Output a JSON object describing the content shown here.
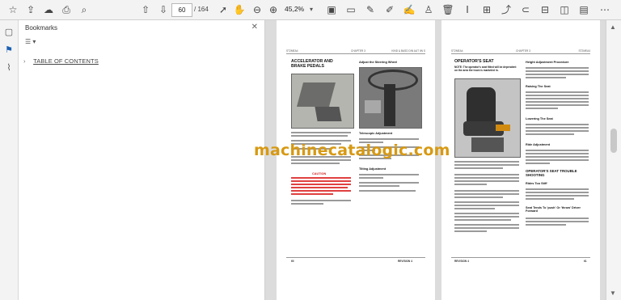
{
  "toolbar": {
    "page_current": "60",
    "page_total": "/ 164",
    "zoom": "45,2%"
  },
  "bookmarks_panel": {
    "title": "Bookmarks",
    "items": [
      {
        "label": "TABLE OF CONTENTS"
      }
    ]
  },
  "document": {
    "left_page": {
      "header_left": "ST2MEA4",
      "header_center": "CHAPTER 3",
      "header_right": "KIND & BASD DIN AUT IIN S",
      "section1_title": "ACCELERATOR AND BRAKE PEDALS",
      "section2_title": "Adjust the Steering Wheel",
      "telescopic_title": "Telescopic Adjustment",
      "tilting_title": "Tilting Adjustment",
      "caution_title": "CAUTION",
      "footer_left": "60",
      "footer_right": "REVISION 4"
    },
    "right_page": {
      "header_left": "ST2MEA4",
      "header_center": "CHAPTER 3",
      "header_right": "ST2MEA4",
      "section1_title": "OPERATOR'S SEAT",
      "note_text": "NOTE: The operator's seat fitted will be dependent on the area the truck is marketed in.",
      "height_title": "Height Adjustment Procedure",
      "raising_title": "Raising The Seat",
      "lowering_title": "Lowering The Seat",
      "ride_title": "Ride Adjustment",
      "trouble_title": "OPERATOR'S SEAT TROUBLE SHOOTING",
      "rides_too_soft": "Rides Too Stiff",
      "seat_tends": "Seat Tends To 'push' Or 'throw' Driver Forward",
      "footer_left": "REVISION 4",
      "footer_right": "61"
    }
  },
  "watermark": "machinecatalogic.com",
  "colors": {
    "watermark": "#d79913",
    "caution_red": "#e04040",
    "toolbar_bg": "#f3f3f3",
    "viewer_bg": "#dcdcdc"
  }
}
